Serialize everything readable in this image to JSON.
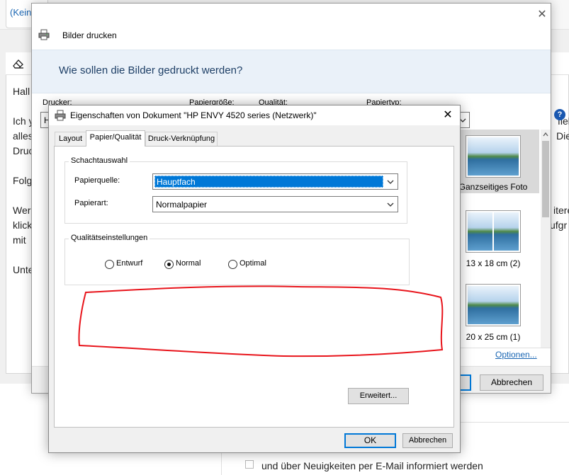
{
  "background": {
    "tab_label": "(Kein",
    "text_left": [
      "Hall",
      "Ich y",
      "alles",
      "Druc",
      "Folg",
      "Wer",
      "klick",
      "mit",
      "Unte"
    ],
    "text_right": [
      "fiel",
      "Die",
      "itere",
      "ufgr"
    ],
    "newsletter_label": "und über Neuigkeiten per E-Mail informiert werden"
  },
  "print_window": {
    "title": "Bilder drucken",
    "heading": "Wie sollen die Bilder gedruckt werden?",
    "field_labels": [
      "Drucker:",
      "Papiergröße:",
      "Qualität:",
      "Papiertyp:"
    ],
    "printer_value_fragment": "H",
    "help_label": "?",
    "layouts": [
      {
        "label": "Ganzseitiges Foto",
        "selected": true
      },
      {
        "label": "13 x 18 cm (2)",
        "selected": false
      },
      {
        "label": "20 x 25 cm (1)",
        "selected": false
      }
    ],
    "options_link": "Optionen...",
    "cancel_button": "Abbrechen"
  },
  "props_dialog": {
    "title": "Eigenschaften von Dokument \"HP ENVY 4520 series (Netzwerk)\"",
    "tabs": [
      "Layout",
      "Papier/Qualität",
      "Druck-Verknüpfung"
    ],
    "active_tab": "Papier/Qualität",
    "tray_group": {
      "title": "Schachtauswahl",
      "source_label": "Papierquelle:",
      "source_value": "Hauptfach",
      "type_label": "Papierart:",
      "type_value": "Normalpapier"
    },
    "quality_group": {
      "title": "Qualitätseinstellungen",
      "options": [
        "Entwurf",
        "Normal",
        "Optimal"
      ],
      "selected": "Normal"
    },
    "advanced_button": "Erweitert...",
    "ok_button": "OK",
    "cancel_button": "Abbrechen"
  },
  "annotation": {
    "color": "#e8141b"
  },
  "colors": {
    "accent": "#0078d7",
    "link": "#1a66b3",
    "heading": "#1e3f66"
  }
}
